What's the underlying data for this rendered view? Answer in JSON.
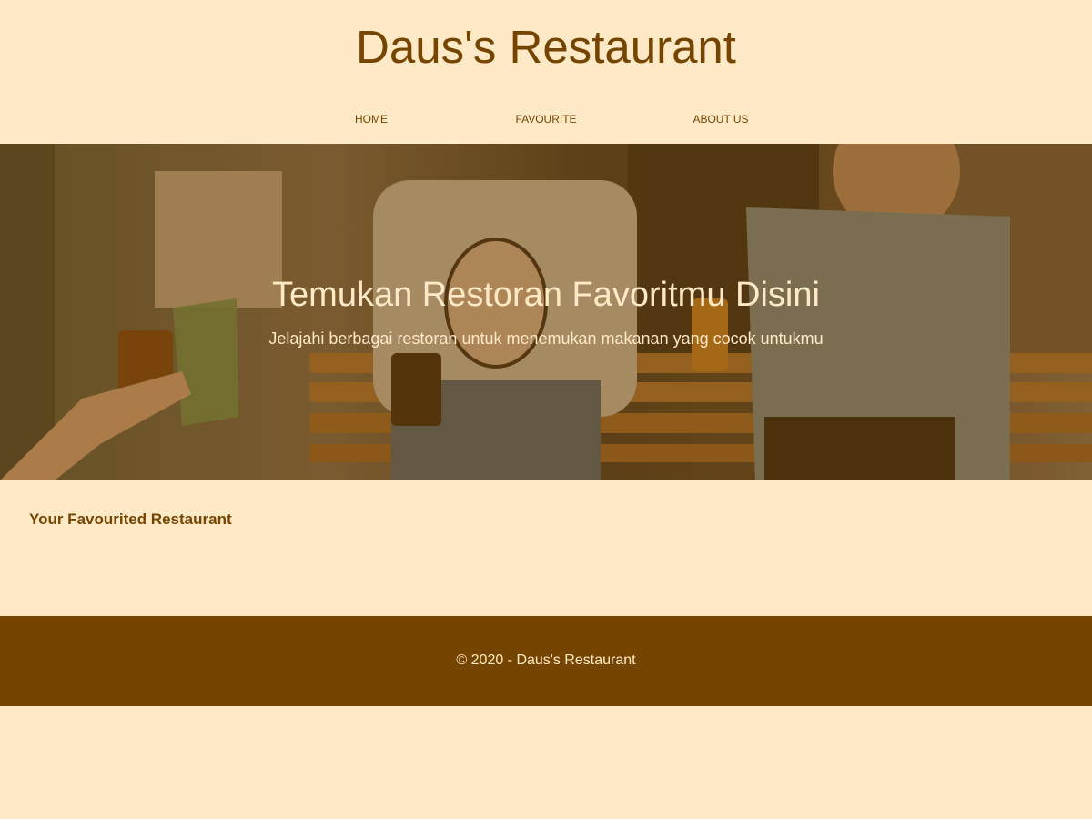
{
  "header": {
    "title": "Daus's Restaurant"
  },
  "nav": {
    "items": [
      {
        "label": "HOME"
      },
      {
        "label": "FAVOURITE"
      },
      {
        "label": "ABOUT US"
      }
    ]
  },
  "hero": {
    "title": "Temukan Restoran Favoritmu Disini",
    "subtitle": "Jelajahi berbagai restoran untuk menemukan makanan yang cocok untukmu"
  },
  "main": {
    "section_title": "Your Favourited Restaurant"
  },
  "footer": {
    "text": "© 2020 - Daus's Restaurant"
  },
  "colors": {
    "background": "#FFE9C7",
    "brand": "#754500",
    "overlay": "#784806"
  }
}
